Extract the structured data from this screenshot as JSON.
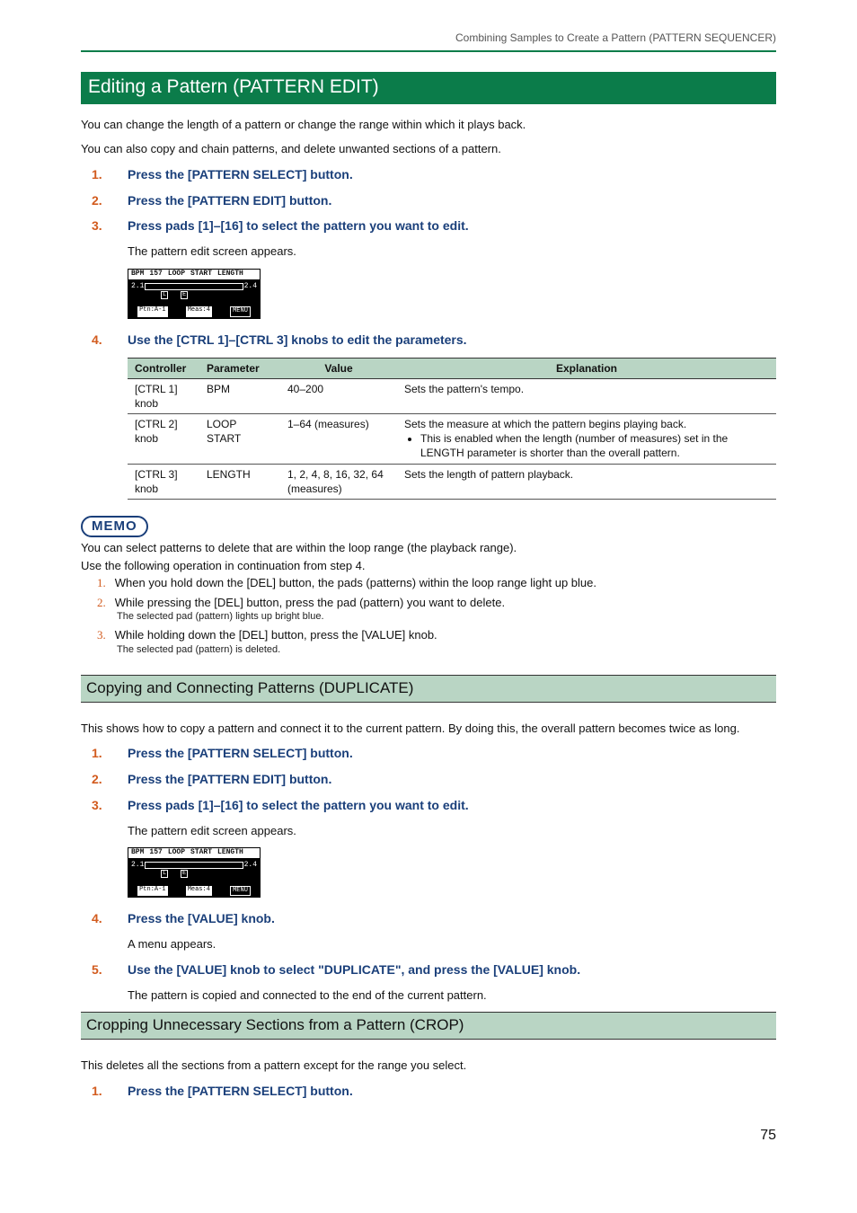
{
  "top_context": "Combining Samples to Create a Pattern (PATTERN SEQUENCER)",
  "h2": "Editing a Pattern (PATTERN EDIT)",
  "intro1": "You can change the length of a pattern or change the range within which it plays back.",
  "intro2": "You can also copy and chain patterns, and delete unwanted sections of a pattern.",
  "stepsA": {
    "s1": "Press the [PATTERN SELECT] button.",
    "s2": "Press the [PATTERN EDIT] button.",
    "s3": "Press pads [1]–[16] to select the pattern you want to edit.",
    "s3_after": "The pattern edit screen appears.",
    "s4": "Use the [CTRL 1]–[CTRL 3] knobs to edit the parameters."
  },
  "screen": {
    "h1": "BPM",
    "h2": "157",
    "h3": "LOOP",
    "h4": "START",
    "h5": "LENGTH",
    "left": "2.1",
    "right": "2.4",
    "ml": "L",
    "me": "E",
    "f1": "Ptn:A-1",
    "f2": "Meas:4",
    "f3": "MENU"
  },
  "table": {
    "th1": "Controller",
    "th2": "Parameter",
    "th3": "Value",
    "th4": "Explanation",
    "r1c1": "[CTRL 1] knob",
    "r1c2": "BPM",
    "r1c3": "40–200",
    "r1c4": "Sets the pattern's tempo.",
    "r2c1": "[CTRL 2] knob",
    "r2c2": "LOOP START",
    "r2c3": "1–64 (measures)",
    "r2c4_main": "Sets the measure at which the pattern begins playing back.",
    "r2c4_bullet": "This is enabled when the length (number of measures) set in the LENGTH parameter is shorter than the overall pattern.",
    "r3c1": "[CTRL 3] knob",
    "r3c2": "LENGTH",
    "r3c3": "1, 2, 4, 8, 16, 32, 64 (measures)",
    "r3c4": "Sets the length of pattern playback."
  },
  "memo": {
    "badge": "MEMO",
    "p1": "You can select patterns to delete that are within the loop range (the playback range).",
    "p2": "Use the following operation in continuation from step 4.",
    "s1": "When you hold down the [DEL] button, the pads (patterns) within the loop range light up blue.",
    "s2": "While pressing the [DEL] button, press the pad (pattern) you want to delete.",
    "s2_sub": "The selected pad (pattern) lights up bright blue.",
    "s3": "While holding down the [DEL] button, press the [VALUE] knob.",
    "s3_sub": "The selected pad (pattern) is deleted."
  },
  "h3_dup": "Copying and Connecting Patterns (DUPLICATE)",
  "dup_intro": "This shows how to copy a pattern and connect it to the current pattern. By doing this, the overall pattern becomes twice as long.",
  "stepsB": {
    "s1": "Press the [PATTERN SELECT] button.",
    "s2": "Press the [PATTERN EDIT] button.",
    "s3": "Press pads [1]–[16] to select the pattern you want to edit.",
    "s3_after": "The pattern edit screen appears.",
    "s4": "Press the [VALUE] knob.",
    "s4_after": "A menu appears.",
    "s5": "Use the [VALUE] knob to select \"DUPLICATE\", and press the [VALUE] knob.",
    "s5_after": "The pattern is copied and connected to the end of the current pattern."
  },
  "h3_crop": "Cropping Unnecessary Sections from a Pattern (CROP)",
  "crop_intro": "This deletes all the sections from a pattern except for the range you select.",
  "stepsC": {
    "s1": "Press the [PATTERN SELECT] button."
  },
  "page_num": "75"
}
